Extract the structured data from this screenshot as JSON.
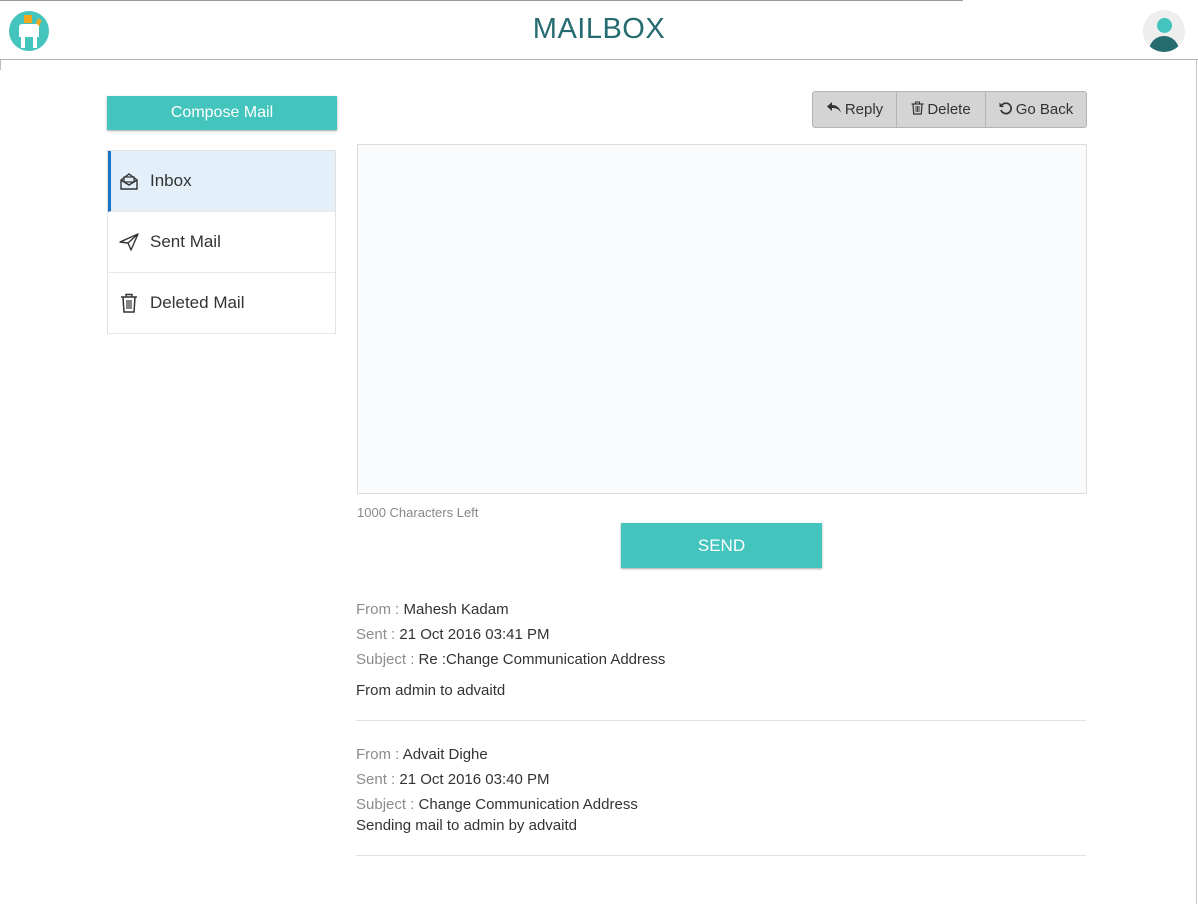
{
  "header": {
    "title": "MAILBOX",
    "logo_icon": "mailbox-logo-icon",
    "avatar_icon": "user-avatar-icon"
  },
  "sidebar": {
    "compose_label": "Compose Mail",
    "items": [
      {
        "label": "Inbox",
        "icon": "envelope-open-icon",
        "active": true
      },
      {
        "label": "Sent Mail",
        "icon": "paper-plane-icon",
        "active": false
      },
      {
        "label": "Deleted Mail",
        "icon": "trash-icon",
        "active": false
      }
    ]
  },
  "toolbar": {
    "reply_label": "Reply",
    "delete_label": "Delete",
    "goback_label": "Go Back"
  },
  "composer": {
    "value": "",
    "placeholder": "",
    "chars_left": "1000 Characters Left",
    "send_label": "SEND"
  },
  "messages": [
    {
      "from_label": "From :",
      "from": "Mahesh Kadam",
      "sent_label": "Sent :",
      "sent": "21 Oct 2016 03:41 PM",
      "subject_label": "Subject :",
      "subject": "Re :Change Communication Address",
      "body": "From admin to advaitd"
    },
    {
      "from_label": "From :",
      "from": "Advait Dighe",
      "sent_label": "Sent :",
      "sent": "21 Oct 2016 03:40 PM",
      "subject_label": "Subject :",
      "subject": "Change Communication Address",
      "body": "Sending mail to admin by advaitd"
    }
  ],
  "colors": {
    "accent": "#43c4bd",
    "title": "#266b6f",
    "active_bg": "#e3f0fa",
    "active_border": "#1a73c8",
    "button_gray": "#d4d4d4"
  }
}
